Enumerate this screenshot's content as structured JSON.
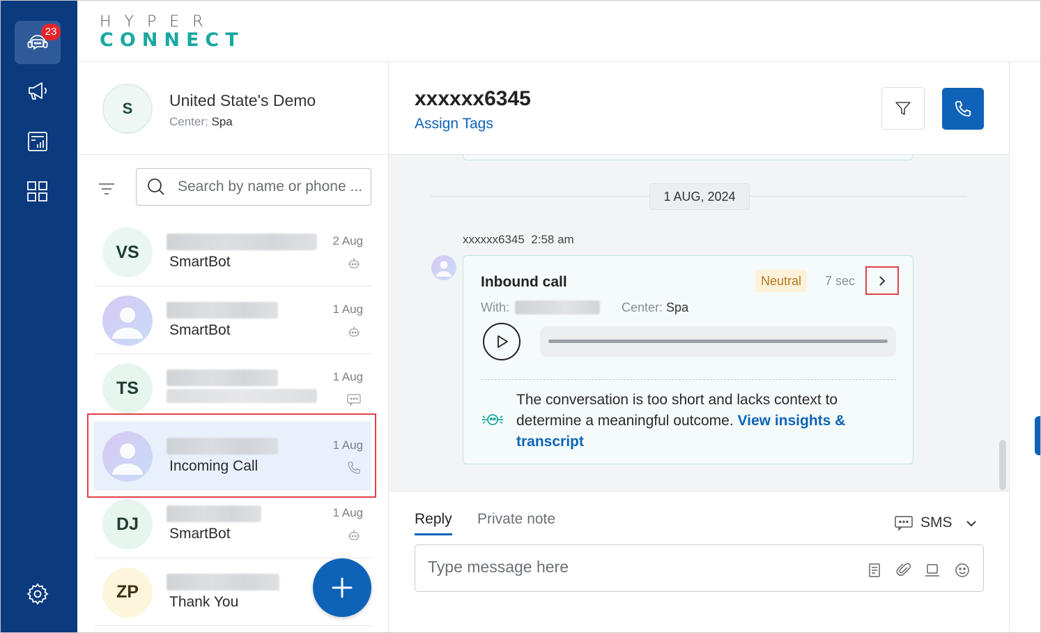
{
  "app": {
    "logo_top": "HYPER",
    "logo_bottom": "CONNECT",
    "notification_count": "23"
  },
  "rail": {
    "items": [
      {
        "icon": "headset-chat-icon",
        "active": true
      },
      {
        "icon": "megaphone-icon",
        "active": false
      },
      {
        "icon": "report-icon",
        "active": false
      },
      {
        "icon": "apps-grid-icon",
        "active": false
      }
    ],
    "settings_icon": "gear-icon"
  },
  "account": {
    "initial": "S",
    "name": "United State's Demo",
    "center_label": "Center:",
    "center_value": "Spa"
  },
  "search": {
    "placeholder": "Search by name or phone ..."
  },
  "conversations": [
    {
      "initials": "VS",
      "subtitle": "SmartBot",
      "date": "2 Aug",
      "channel": "bot-icon",
      "avatar_bg": "#eaf6f2",
      "avatar_color": "#1d3b32",
      "selected": false
    },
    {
      "initials": "",
      "subtitle": "SmartBot",
      "date": "1 Aug",
      "channel": "bot-icon",
      "avatar_bg": "gradient",
      "selected": false
    },
    {
      "initials": "TS",
      "subtitle": "",
      "date": "1 Aug",
      "channel": "sms-icon",
      "avatar_bg": "#e6f5ee",
      "avatar_color": "#1d3b32",
      "selected": false
    },
    {
      "initials": "",
      "subtitle": "Incoming Call",
      "date": "1 Aug",
      "channel": "phone-icon",
      "avatar_bg": "gradient",
      "selected": true
    },
    {
      "initials": "DJ",
      "subtitle": "SmartBot",
      "date": "1 Aug",
      "channel": "bot-icon",
      "avatar_bg": "#e6f5ee",
      "avatar_color": "#1d3b32",
      "selected": false
    },
    {
      "initials": "ZP",
      "subtitle": "Thank You",
      "date": "",
      "channel": "",
      "avatar_bg": "#fdf5dc",
      "avatar_color": "#3d3015",
      "selected": false
    }
  ],
  "chat": {
    "title": "xxxxxx6345",
    "assign_tags": "Assign Tags",
    "date_divider": "1 AUG, 2024",
    "message_meta": "xxxxxx6345  2:58 am",
    "card": {
      "title": "Inbound call",
      "sentiment": "Neutral",
      "duration": "7 sec",
      "with_label": "With:",
      "center_label": "Center:",
      "center_value": "Spa",
      "insight_text": "The conversation is too short and lacks context to determine a meaningful outcome.",
      "insight_link": "View insights & transcript"
    }
  },
  "reply": {
    "tab_reply": "Reply",
    "tab_private": "Private note",
    "channel": "SMS",
    "placeholder": "Type message here"
  },
  "colors": {
    "rail": "#0b3a7e",
    "accent": "#0e63b8",
    "teal": "#1aa8a0",
    "highlight": "#e04047"
  }
}
